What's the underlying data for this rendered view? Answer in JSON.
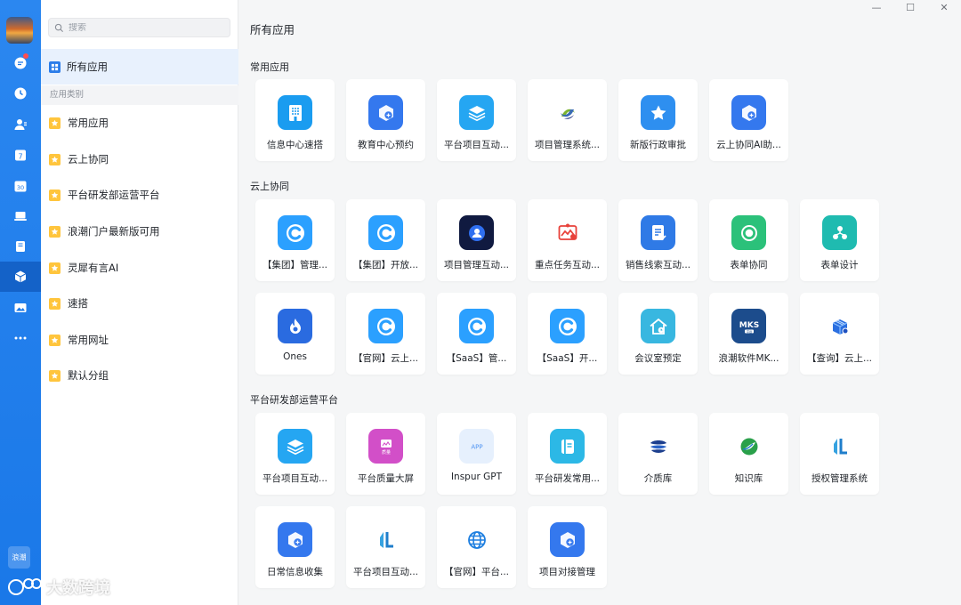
{
  "window": {
    "minimize": "—",
    "maximize": "☐",
    "close": "✕"
  },
  "rail": {
    "brand_label": "浪潮",
    "icons": [
      "chat-icon",
      "clock-icon",
      "contacts-icon",
      "calendar-7-icon",
      "calendar-30-icon",
      "laptop-icon",
      "book-icon",
      "apps-cube-icon",
      "image-icon",
      "more-icon"
    ]
  },
  "sidebar": {
    "search_placeholder": "搜索",
    "all_label": "所有应用",
    "category_header": "应用类别",
    "categories": [
      "常用应用",
      "云上协同",
      "平台研发部运营平台",
      "浪潮门户最新版可用",
      "灵犀有言AI",
      "速搭",
      "常用网址",
      "默认分组"
    ]
  },
  "main": {
    "title": "所有应用",
    "sections": [
      {
        "title": "常用应用",
        "apps": [
          "信息中心速搭",
          "教育中心预约",
          "平台项目互动...",
          "项目管理系统...",
          "新版行政审批",
          "云上协同AI助..."
        ]
      },
      {
        "title": "云上协同",
        "apps": [
          "【集团】管理...",
          "【集团】开放...",
          "项目管理互动...",
          "重点任务互动...",
          "销售线索互动...",
          "表单协同",
          "表单设计",
          "Ones",
          "【官网】云上...",
          "【SaaS】管...",
          "【SaaS】开...",
          "会议室预定",
          "浪潮软件MK...",
          "【查询】云上..."
        ]
      },
      {
        "title": "平台研发部运营平台",
        "apps": [
          "平台项目互动...",
          "平台质量大屏",
          "Inspur GPT",
          "平台研发常用...",
          "介质库",
          "知识库",
          "授权管理系统",
          "日常信息收集",
          "平台项目互动...",
          "【官网】平台...",
          "项目对接管理"
        ]
      }
    ]
  },
  "logo_text": {
    "mks": "MKS",
    "mks_sub": "平台",
    "quality": "质量",
    "app": "APP"
  },
  "watermark": "大数跨境",
  "colors": {
    "rail": "#1a78e8",
    "accent": "#2b7de9",
    "star": "#ffc53d",
    "selected_bg": "#e8f1fd"
  }
}
